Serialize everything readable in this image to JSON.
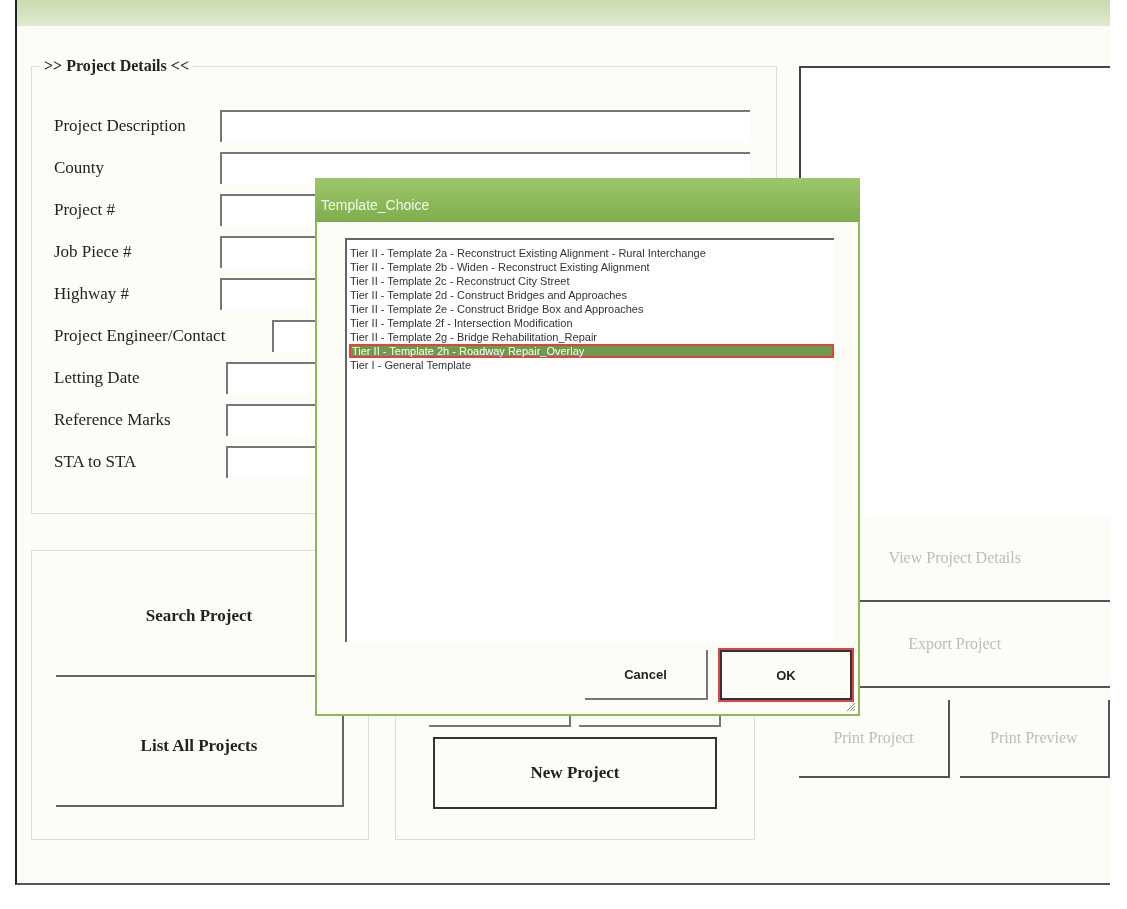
{
  "details": {
    "legend": ">> Project Details <<",
    "fields": [
      {
        "label": "Project Description"
      },
      {
        "label": "County"
      },
      {
        "label": "Project #"
      },
      {
        "label": "Job Piece #"
      },
      {
        "label": "Highway #"
      },
      {
        "label": "Project Engineer/Contact"
      },
      {
        "label": "Letting Date"
      },
      {
        "label": "Reference Marks"
      },
      {
        "label": "STA to STA"
      }
    ]
  },
  "left_buttons": [
    {
      "label": "Search Project"
    },
    {
      "label": "List All Projects"
    }
  ],
  "middle_buttons": [
    {
      "label": "New Project"
    }
  ],
  "right_buttons": [
    {
      "label": "View Project Details",
      "disabled": true
    },
    {
      "label": "Export Project",
      "disabled": true
    }
  ],
  "print_buttons": [
    {
      "label": "Print Project",
      "disabled": true
    },
    {
      "label": "Print Preview",
      "disabled": true
    }
  ],
  "dialog": {
    "title": "Template_Choice",
    "items": [
      {
        "label": "Tier II - Template 2a - Reconstruct Existing Alignment - Rural Interchange",
        "selected": false
      },
      {
        "label": "Tier II - Template 2b - Widen - Reconstruct Existing Alignment",
        "selected": false
      },
      {
        "label": "Tier II - Template 2c - Reconstruct City Street",
        "selected": false
      },
      {
        "label": "Tier II - Template 2d - Construct Bridges and Approaches",
        "selected": false
      },
      {
        "label": "Tier II - Template 2e - Construct Bridge Box and Approaches",
        "selected": false
      },
      {
        "label": "Tier II - Template 2f  - Intersection Modification",
        "selected": false
      },
      {
        "label": "Tier II - Template 2g - Bridge Rehabilitation_Repair",
        "selected": false
      },
      {
        "label": "Tier II - Template 2h - Roadway Repair_Overlay",
        "selected": true
      },
      {
        "label": "Tier I - General Template",
        "selected": false
      }
    ],
    "buttons": [
      {
        "label": "Cancel",
        "default": false
      },
      {
        "label": "OK",
        "default": true
      }
    ]
  }
}
